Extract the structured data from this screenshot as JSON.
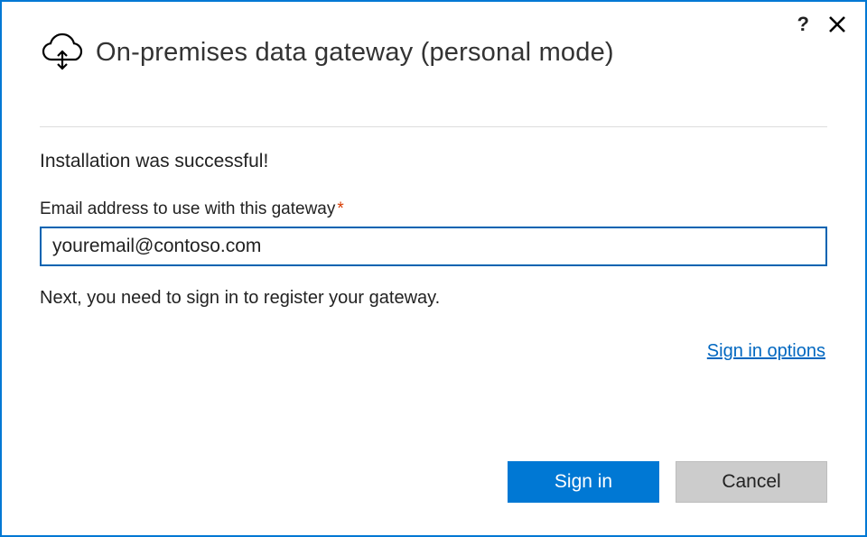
{
  "header": {
    "title": "On-premises data gateway (personal mode)"
  },
  "content": {
    "success_message": "Installation was successful!",
    "email_label": "Email address to use with this gateway",
    "required_marker": "*",
    "email_value": "youremail@contoso.com",
    "next_instruction": "Next, you need to sign in to register your gateway.",
    "signin_options_label": "Sign in options"
  },
  "buttons": {
    "signin_label": "Sign in",
    "cancel_label": "Cancel"
  },
  "colors": {
    "accent": "#0078d4",
    "link": "#0067c0",
    "required": "#d83b01"
  }
}
